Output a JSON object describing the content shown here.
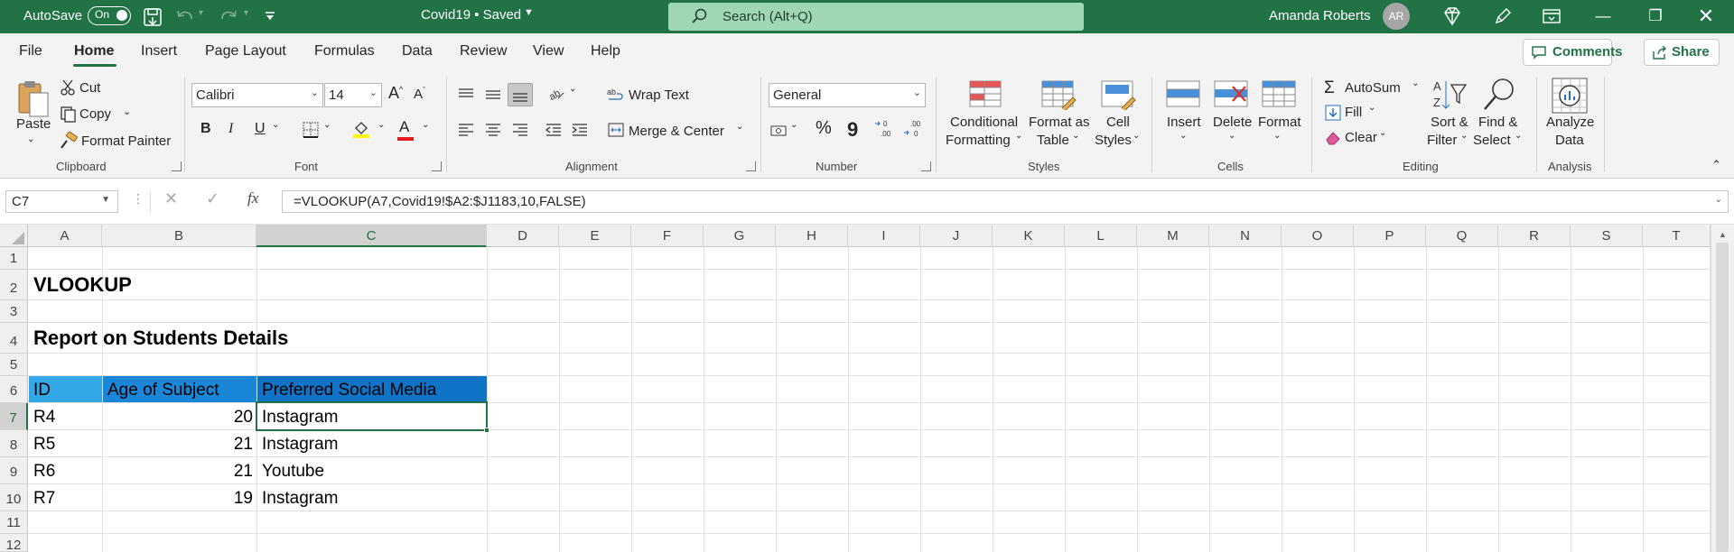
{
  "titlebar": {
    "autosave_label": "AutoSave",
    "autosave_state": "On",
    "doc_title": "Covid19 • Saved",
    "search_placeholder": "Search (Alt+Q)",
    "user_name": "Amanda Roberts",
    "user_initials": "AR",
    "bg_color": "#217346"
  },
  "tabs": [
    "File",
    "Home",
    "Insert",
    "Page Layout",
    "Formulas",
    "Data",
    "Review",
    "View",
    "Help"
  ],
  "active_tab": "Home",
  "top_actions": {
    "comments": "Comments",
    "share": "Share"
  },
  "ribbon": {
    "clipboard": {
      "paste": "Paste",
      "cut": "Cut",
      "copy": "Copy",
      "format_painter": "Format Painter",
      "label": "Clipboard"
    },
    "font": {
      "name": "Calibri",
      "size": "14",
      "bold": "B",
      "italic": "I",
      "underline": "U",
      "label": "Font"
    },
    "alignment": {
      "wrap_text": "Wrap Text",
      "merge_center": "Merge & Center",
      "label": "Alignment"
    },
    "number": {
      "format": "General",
      "percent": "%",
      "comma": "9",
      "label": "Number"
    },
    "styles": {
      "conditional_1": "Conditional",
      "conditional_2": "Formatting",
      "format_table_1": "Format as",
      "format_table_2": "Table",
      "cell_styles_1": "Cell",
      "cell_styles_2": "Styles",
      "label": "Styles"
    },
    "cells": {
      "insert": "Insert",
      "delete": "Delete",
      "format": "Format",
      "label": "Cells"
    },
    "editing": {
      "autosum": "AutoSum",
      "fill": "Fill",
      "clear": "Clear",
      "sort_1": "Sort &",
      "sort_2": "Filter",
      "find_1": "Find &",
      "find_2": "Select",
      "label": "Editing"
    },
    "analysis": {
      "analyze_1": "Analyze",
      "analyze_2": "Data",
      "label": "Analysis"
    }
  },
  "formula_bar": {
    "name_box": "C7",
    "formula": "=VLOOKUP(A7,Covid19!$A2:$J1183,10,FALSE)"
  },
  "sheet": {
    "columns": [
      "A",
      "B",
      "C",
      "D",
      "E",
      "F",
      "G",
      "H",
      "I",
      "J",
      "K",
      "L",
      "M",
      "N",
      "O",
      "P",
      "Q",
      "R",
      "S",
      "T"
    ],
    "rows": [
      "1",
      "2",
      "3",
      "4",
      "5",
      "6",
      "7",
      "8",
      "9",
      "10",
      "11",
      "12"
    ],
    "selected_column": "C",
    "selected_row": "7",
    "title": "VLOOKUP",
    "subtitle": "Report on Students Details",
    "headers": [
      "ID",
      "Age of Subject",
      "Preferred Social Media"
    ],
    "data": [
      [
        "R4",
        "20",
        "Instagram"
      ],
      [
        "R5",
        "21",
        "Instagram"
      ],
      [
        "R6",
        "21",
        "Youtube"
      ],
      [
        "R7",
        "19",
        "Instagram"
      ]
    ]
  }
}
